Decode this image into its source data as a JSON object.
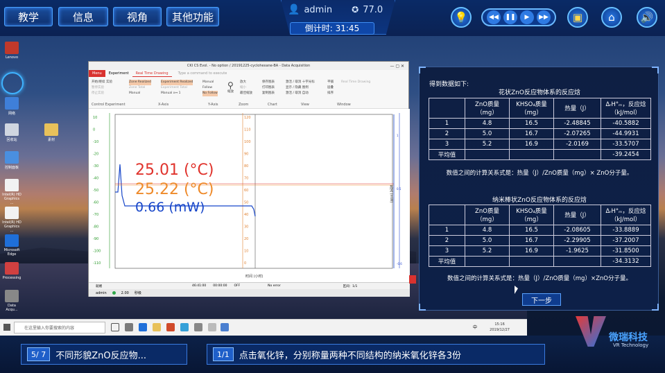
{
  "topbar": {
    "menu": [
      "教学",
      "信息",
      "视角",
      "其他功能"
    ],
    "user": "admin",
    "score": "77.0",
    "timer": "倒计时: 31:45"
  },
  "desktop": {
    "icons": [
      "Lenovo",
      "网络",
      "回收站",
      "素材",
      "控制面板",
      "Intel(R) HD Graphics ...",
      "Intel(R) HD Graphics ...",
      "Microsoft Edge",
      "Processing",
      "Data Acqu..."
    ]
  },
  "app": {
    "title": "CKI CS Evol. - No option / 20191225-cyclohexane-BA - Data Acquisition",
    "tabs": [
      "Menu",
      "Experiment",
      "Real Time Drawing"
    ],
    "command_placeholder": "Type a command to execute",
    "groups": [
      "Control Experiment",
      "X-Axis",
      "Y-Axis",
      "Zoom",
      "Chart",
      "View",
      "Window"
    ],
    "control_items": [
      "开始/继续 实验",
      "暂停实验",
      "停止实验"
    ],
    "xaxis_items": [
      "Zone Realized",
      "Zone Total",
      "Manual"
    ],
    "xaxis_items2": [
      "Experiment Realized",
      "Experiment Total",
      "Manual x↔ 1"
    ],
    "yaxis_items": [
      "Manual",
      "Follow",
      "No Follow"
    ],
    "zoom_items": [
      "放大",
      "缩小",
      "最佳缩放"
    ],
    "zoom_btn": "缩放",
    "chart_items": [
      "保存图表",
      "打印图表",
      "复制图表"
    ],
    "view_items": [
      "激活 / 取消 十字光标",
      "显示 / 隐藏 图例",
      "激活 / 取消 自动"
    ],
    "window_items": [
      "平铺",
      "层叠",
      "排序"
    ],
    "realtime": "Real Time Drawing",
    "readouts": [
      "25.01 (°C)",
      "25.22 (°C)",
      "0.66 (mW)"
    ],
    "right_axis_label": "热流 (mW)",
    "x_axis_label": "时间 (小时)",
    "status": [
      "就绪",
      "46:41:00",
      "00:00:00",
      "OFF",
      "No error",
      "区间：1/1"
    ],
    "status2": [
      "admin",
      "2.00",
      "秒级"
    ]
  },
  "taskbar": {
    "search_placeholder": "在这里输入你要搜索的内容",
    "time": "15:16",
    "date": "2019/12/27",
    "lang": "中"
  },
  "panel": {
    "intro": "得到数据如下:",
    "table1": {
      "title": "花状ZnO反应物体系的反应焓",
      "headers": [
        "",
        "ZnO质量（mg）",
        "KHSO₄质量（mg）",
        "热量（J）",
        "ΔᵣH°ₘ，反应焓（kJ/mol）"
      ],
      "rows": [
        [
          "1",
          "4.8",
          "16.5",
          "-2.48845",
          "-40.5882"
        ],
        [
          "2",
          "5.0",
          "16.7",
          "-2.07265",
          "-44.9931"
        ],
        [
          "3",
          "5.2",
          "16.9",
          "-2.0169",
          "-33.5707"
        ],
        [
          "平均值",
          "",
          "",
          "",
          "-39.2454"
        ]
      ],
      "formula": "数值之间的计算关系式是：热量（J）/ZnO质量（mg）× ZnO分子量。"
    },
    "table2": {
      "title": "纳米棒状ZnO反应物体系的反应焓",
      "headers": [
        "",
        "ZnO质量（mg）",
        "KHSO₄质量（mg）",
        "热量（J）",
        "ΔᵣH°ₘ，反应焓（kJ/mol）"
      ],
      "rows": [
        [
          "1",
          "4.8",
          "16.5",
          "-2.08605",
          "-33.8889"
        ],
        [
          "2",
          "5.0",
          "16.7",
          "-2.29905",
          "-37.2007"
        ],
        [
          "3",
          "5.2",
          "16.9",
          "-1.9625",
          "-31.8500"
        ],
        [
          "平均值",
          "",
          "",
          "",
          "-34.3132"
        ]
      ],
      "formula": "数值之间的计算关系式是：热量（J）/ZnO质量（mg）×ZnO分子量。"
    },
    "next_button": "下一步"
  },
  "bottom": {
    "step_badge": "5/ 7",
    "step_text": "不同形貌ZnO反应物...",
    "sub_badge": "1/1",
    "sub_text": "点击氧化锌，分别称量两种不同结构的纳米氧化锌各3份"
  },
  "logo": {
    "name": "微瑞科技",
    "en": "VR Technology"
  },
  "colors": {
    "accent": "#4aa3ff",
    "panel_bg": "#0e1f43",
    "red_readout": "#e0332c",
    "orange_readout": "#ee8a2a",
    "blue_readout": "#1746c9"
  }
}
